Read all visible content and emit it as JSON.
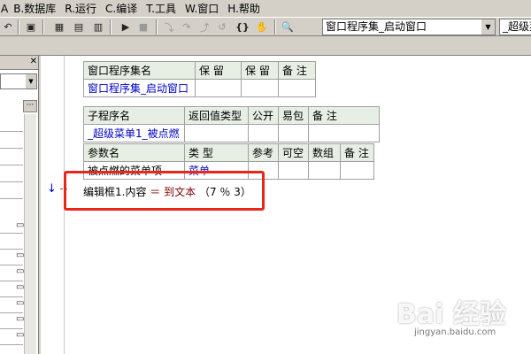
{
  "menu": [
    {
      "key": "B",
      "label": "B.数据库"
    },
    {
      "key": "R",
      "label": "R.运行"
    },
    {
      "key": "C",
      "label": "C.编译"
    },
    {
      "key": "T",
      "label": "T.工具"
    },
    {
      "key": "W",
      "label": "W.窗口"
    },
    {
      "key": "H",
      "label": "H.帮助"
    }
  ],
  "menu_first_fragment": "A",
  "toolbar": {
    "combo_window": "窗口程序集_启动窗口",
    "combo_sub": "_超级菜"
  },
  "window_table": {
    "headers": [
      "窗口程序集名",
      "保 留",
      "保 留",
      "备 注"
    ],
    "row": [
      "窗口程序集_启动窗口",
      "",
      "",
      ""
    ]
  },
  "sub_table": {
    "headers": [
      "子程序名",
      "返回值类型",
      "公开",
      "易包",
      "备 注"
    ],
    "row": [
      "_超级菜单1_被点燃",
      "",
      "",
      "",
      ""
    ],
    "param_headers": [
      "参数名",
      "类 型",
      "参考",
      "可空",
      "数组",
      "备 注"
    ],
    "param_row": [
      "被点燃的菜单项",
      "菜单",
      "",
      "",
      "",
      ""
    ]
  },
  "code": {
    "target": "编辑框1.内容",
    "op": "＝",
    "fn": "到文本",
    "args": "（7 ％ 3）"
  },
  "watermark": {
    "main": "Bai 经验",
    "sub": "jingyan.baidu.com"
  },
  "colors": {
    "header_bg": "#e7efe4",
    "value_blue": "#0000c8",
    "highlight_red": "#e8261c"
  }
}
